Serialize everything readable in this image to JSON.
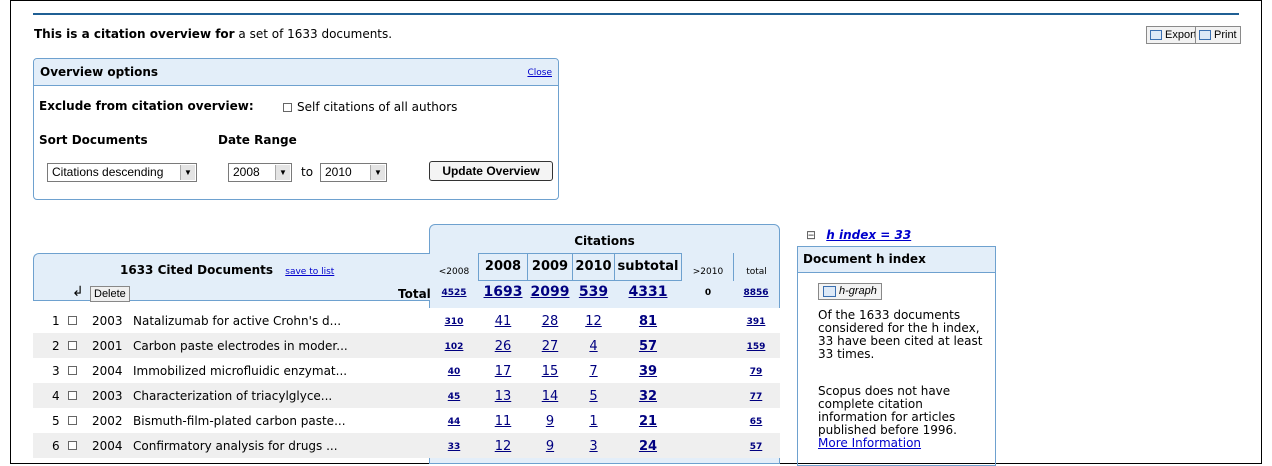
{
  "intro": {
    "bold": "This is a citation overview for",
    "rest": " a set of 1633 documents."
  },
  "toolbar": {
    "export_label": "Export",
    "print_label": "Print"
  },
  "options": {
    "title": "Overview options",
    "close_label": "Close",
    "exclude_label": "Exclude from citation overview:",
    "self_citations_label": "Self citations of all authors",
    "sort_label": "Sort Documents",
    "sort_value": "Citations descending",
    "date_label": "Date Range",
    "from_year": "2008",
    "to_label": "to",
    "to_year": "2010",
    "update_label": "Update Overview"
  },
  "table": {
    "citations_title": "Citations",
    "docs_title": "1633 Cited Documents",
    "save_label": "save to list",
    "delete_label": "Delete",
    "total_label": "Total",
    "headers": [
      "<2008",
      "2008",
      "2009",
      "2010",
      "subtotal",
      ">2010",
      "total"
    ],
    "totals": [
      "4525",
      "1693",
      "2099",
      "539",
      "4331",
      "0",
      "8856"
    ],
    "rows": [
      {
        "num": "1",
        "year": "2003",
        "title": "Natalizumab for active Crohn's d...",
        "c": [
          "310",
          "41",
          "28",
          "12",
          "81",
          "",
          "391"
        ]
      },
      {
        "num": "2",
        "year": "2001",
        "title": "Carbon paste electrodes in moder...",
        "c": [
          "102",
          "26",
          "27",
          "4",
          "57",
          "",
          "159"
        ]
      },
      {
        "num": "3",
        "year": "2004",
        "title": "Immobilized microfluidic enzymat...",
        "c": [
          "40",
          "17",
          "15",
          "7",
          "39",
          "",
          "79"
        ]
      },
      {
        "num": "4",
        "year": "2003",
        "title": "Characterization of triacylglyce...",
        "c": [
          "45",
          "13",
          "14",
          "5",
          "32",
          "",
          "77"
        ]
      },
      {
        "num": "5",
        "year": "2002",
        "title": "Bismuth-film-plated carbon paste...",
        "c": [
          "44",
          "11",
          "9",
          "1",
          "21",
          "",
          "65"
        ]
      },
      {
        "num": "6",
        "year": "2004",
        "title": "Confirmatory analysis for drugs ...",
        "c": [
          "33",
          "12",
          "9",
          "3",
          "24",
          "",
          "57"
        ]
      }
    ]
  },
  "hindex": {
    "toggle": "⊟",
    "heading": "h index = 33",
    "box_title": "Document h index",
    "graph_label": "h-graph",
    "text1": "Of the 1633 documents considered for the h index, 33 have been cited at least 33 times.",
    "text2": "Scopus does not have complete citation information for articles published before 1996.",
    "more_label": "More Information"
  },
  "colors": {
    "accent": "#1f5f94",
    "panel": "#e3eef9",
    "border": "#6ea1cf",
    "link": "#000080"
  }
}
